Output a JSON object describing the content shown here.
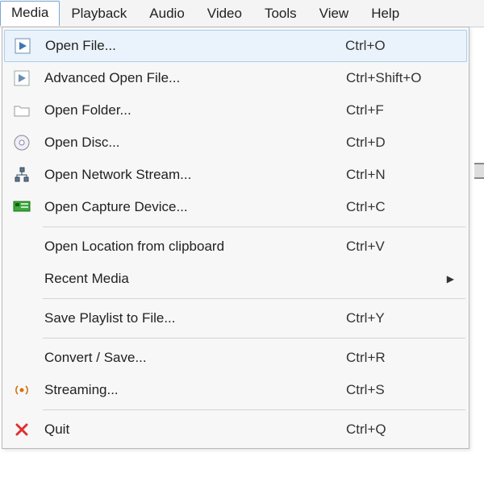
{
  "menubar": {
    "items": [
      {
        "label": "Media",
        "active": true
      },
      {
        "label": "Playback"
      },
      {
        "label": "Audio"
      },
      {
        "label": "Video"
      },
      {
        "label": "Tools"
      },
      {
        "label": "View"
      },
      {
        "label": "Help"
      }
    ]
  },
  "dropdown": {
    "groups": [
      [
        {
          "icon": "play-file-icon",
          "label": "Open File...",
          "shortcut": "Ctrl+O",
          "highlighted": true
        },
        {
          "icon": "play-file-icon",
          "label": "Advanced Open File...",
          "shortcut": "Ctrl+Shift+O"
        },
        {
          "icon": "folder-icon",
          "label": "Open Folder...",
          "shortcut": "Ctrl+F"
        },
        {
          "icon": "disc-icon",
          "label": "Open Disc...",
          "shortcut": "Ctrl+D"
        },
        {
          "icon": "network-icon",
          "label": "Open Network Stream...",
          "shortcut": "Ctrl+N"
        },
        {
          "icon": "capture-card-icon",
          "label": "Open Capture Device...",
          "shortcut": "Ctrl+C"
        }
      ],
      [
        {
          "icon": "",
          "label": "Open Location from clipboard",
          "shortcut": "Ctrl+V"
        },
        {
          "icon": "",
          "label": "Recent Media",
          "shortcut": "",
          "submenu": true
        }
      ],
      [
        {
          "icon": "",
          "label": "Save Playlist to File...",
          "shortcut": "Ctrl+Y"
        }
      ],
      [
        {
          "icon": "",
          "label": "Convert / Save...",
          "shortcut": "Ctrl+R"
        },
        {
          "icon": "stream-icon",
          "label": "Streaming...",
          "shortcut": "Ctrl+S"
        }
      ],
      [
        {
          "icon": "close-icon",
          "label": "Quit",
          "shortcut": "Ctrl+Q"
        }
      ]
    ]
  }
}
